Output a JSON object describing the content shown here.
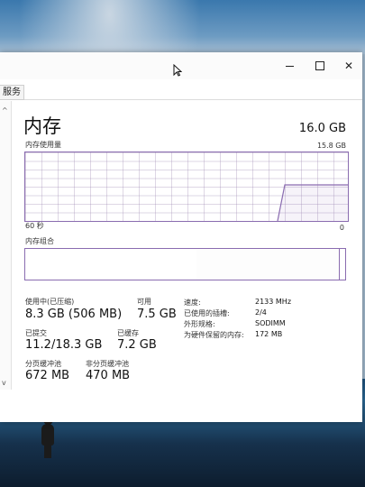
{
  "tabs": {
    "services": "服务"
  },
  "header": {
    "title": "内存",
    "total": "16.0 GB"
  },
  "usage_graph": {
    "label": "内存使用量",
    "max": "15.8 GB",
    "axis_left": "60 秒",
    "axis_right": "0",
    "fill_fraction_recent": 0.53
  },
  "composition": {
    "label": "内存组合"
  },
  "stats": {
    "in_use": {
      "label": "使用中(已压缩)",
      "value": "8.3 GB (506 MB)"
    },
    "available": {
      "label": "可用",
      "value": "7.5 GB"
    },
    "committed": {
      "label": "已提交",
      "value": "11.2/18.3 GB"
    },
    "cached": {
      "label": "已缓存",
      "value": "7.2 GB"
    },
    "paged_pool": {
      "label": "分页缓冲池",
      "value": "672 MB"
    },
    "nonpaged_pool": {
      "label": "非分页缓冲池",
      "value": "470 MB"
    }
  },
  "details": [
    {
      "key": "速度:",
      "value": "2133 MHz"
    },
    {
      "key": "已使用的插槽:",
      "value": "2/4"
    },
    {
      "key": "外形规格:",
      "value": "SODIMM"
    },
    {
      "key": "为硬件保留的内存:",
      "value": "172 MB"
    }
  ],
  "colors": {
    "graph_line": "#8a6cb0"
  }
}
